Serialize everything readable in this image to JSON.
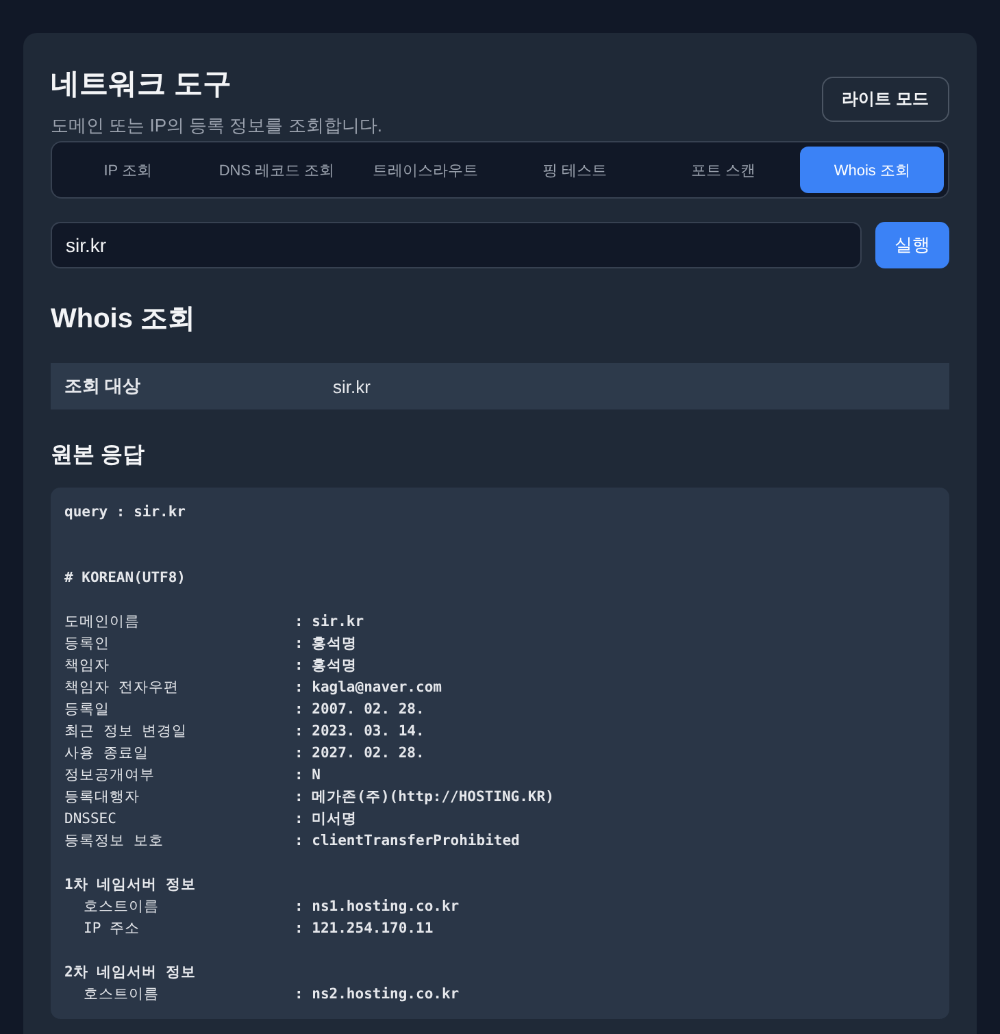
{
  "header": {
    "title": "네트워크 도구",
    "subtitle": "도메인 또는 IP의 등록 정보를 조회합니다.",
    "theme_button": "라이트 모드"
  },
  "tabs": [
    {
      "label": "IP 조회",
      "selected": false
    },
    {
      "label": "DNS 레코드 조회",
      "selected": false
    },
    {
      "label": "트레이스라우트",
      "selected": false
    },
    {
      "label": "핑 테스트",
      "selected": false
    },
    {
      "label": "포트 스캔",
      "selected": false
    },
    {
      "label": "Whois 조회",
      "selected": true
    }
  ],
  "query": {
    "value": "sir.kr",
    "button": "실행"
  },
  "result": {
    "title": "Whois 조회",
    "summary": [
      {
        "label": "조회 대상",
        "value": "sir.kr"
      }
    ],
    "raw_title": "원본 응답",
    "raw_lines": [
      {
        "kind": "text",
        "text": "query : sir.kr"
      },
      {
        "kind": "blank"
      },
      {
        "kind": "blank"
      },
      {
        "kind": "text",
        "text": "# KOREAN(UTF8)"
      },
      {
        "kind": "blank"
      },
      {
        "kind": "field",
        "label": "도메인이름",
        "value": ": sir.kr"
      },
      {
        "kind": "field",
        "label": "등록인",
        "value": ": 홍석명"
      },
      {
        "kind": "field",
        "label": "책임자",
        "value": ": 홍석명"
      },
      {
        "kind": "field",
        "label": "책임자 전자우편",
        "value": ": kagla@naver.com"
      },
      {
        "kind": "field",
        "label": "등록일",
        "value": ": 2007. 02. 28."
      },
      {
        "kind": "field",
        "label": "최근 정보 변경일",
        "value": ": 2023. 03. 14."
      },
      {
        "kind": "field",
        "label": "사용 종료일",
        "value": ": 2027. 02. 28."
      },
      {
        "kind": "field",
        "label": "정보공개여부",
        "value": ": N"
      },
      {
        "kind": "field",
        "label": "등록대행자",
        "value": ": 메가존(주)(http://HOSTING.KR)"
      },
      {
        "kind": "field",
        "label": "DNSSEC",
        "value": ": 미서명"
      },
      {
        "kind": "field",
        "label": "등록정보 보호",
        "value": ": clientTransferProhibited"
      },
      {
        "kind": "blank"
      },
      {
        "kind": "text",
        "text": "1차 네임서버 정보"
      },
      {
        "kind": "subfield",
        "label": "호스트이름",
        "value": ": ns1.hosting.co.kr"
      },
      {
        "kind": "subfield",
        "label": "IP 주소",
        "value": ": 121.254.170.11"
      },
      {
        "kind": "blank"
      },
      {
        "kind": "text",
        "text": "2차 네임서버 정보"
      },
      {
        "kind": "subfield",
        "label": "호스트이름",
        "value": ": ns2.hosting.co.kr"
      }
    ]
  }
}
